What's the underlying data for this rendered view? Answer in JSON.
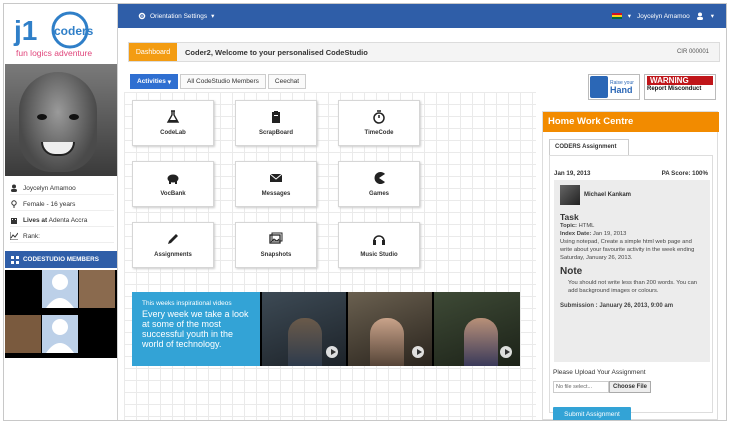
{
  "topbar": {
    "orientation_label": "Orientation Settings",
    "user_name": "Joycelyn Amamoo"
  },
  "logo": {
    "top_text": "j1",
    "coders_text": "coders",
    "tagline": "fun logics adventure"
  },
  "profile": {
    "name": "Joycelyn Amamoo",
    "gender_age": "Female - 16 years",
    "lives_prefix": "Lives at",
    "lives_value": "Adenta Accra",
    "rank_label": "Rank:"
  },
  "members": {
    "title": "CODESTUDIO MEMBERS"
  },
  "header": {
    "badge": "Dashboard",
    "title": "Coder2, Welcome to your personalised CodeStudio",
    "cir": "CIR 000001"
  },
  "tabs": [
    {
      "label": "Activities"
    },
    {
      "label": "All CodeStudio Members"
    },
    {
      "label": "Ceechat"
    }
  ],
  "tiles": [
    {
      "label": "CodeLab",
      "icon": "flask-icon"
    },
    {
      "label": "ScrapBoard",
      "icon": "clipboard-icon"
    },
    {
      "label": "TimeCode",
      "icon": "stopwatch-icon"
    },
    {
      "label": "VocBank",
      "icon": "piggy-bank-icon"
    },
    {
      "label": "Messages",
      "icon": "envelope-icon"
    },
    {
      "label": "Games",
      "icon": "pacman-icon"
    },
    {
      "label": "Assignments",
      "icon": "pencil-icon"
    },
    {
      "label": "Snapshots",
      "icon": "photos-icon"
    },
    {
      "label": "Music Studio",
      "icon": "headphones-icon"
    }
  ],
  "banner": {
    "small": "This weeks inspirational videos",
    "big": "Every week we take a look at some of the most successful youth in the world of technology."
  },
  "report": {
    "raise_small": "Raise your",
    "raise_big": "Hand",
    "warning": "WARNING",
    "misconduct": "Report Misconduct"
  },
  "homework": {
    "title": "Home Work Centre",
    "tab": "CODERS Assignment",
    "date": "Jan 19, 2013",
    "score": "PA Score: 100%",
    "author": "Michael Kankam",
    "task_heading": "Task",
    "topic_label": "Topic:",
    "topic_value": "HTML",
    "index_label": "Index Date:",
    "index_value": "Jan 19, 2013",
    "task_text": "Using notepad, Create a simple html web page and write about your favourite activity in the week ending Saturday, January 26, 2013.",
    "note_heading": "Note",
    "note_text": "You should not write less than 200 words. You can add background images or colours.",
    "submission": "Submission : January 26, 2013, 9:00 am",
    "upload_label": "Please Upload Your Assignment",
    "file_placeholder": "No file select...",
    "choose_file": "Choose File",
    "submit": "Submit Assignment"
  },
  "colors": {
    "primary_blue": "#2f5ea8",
    "accent_orange": "#f28b00",
    "banner_blue": "#33a3d6",
    "warning_red": "#c0161a"
  }
}
